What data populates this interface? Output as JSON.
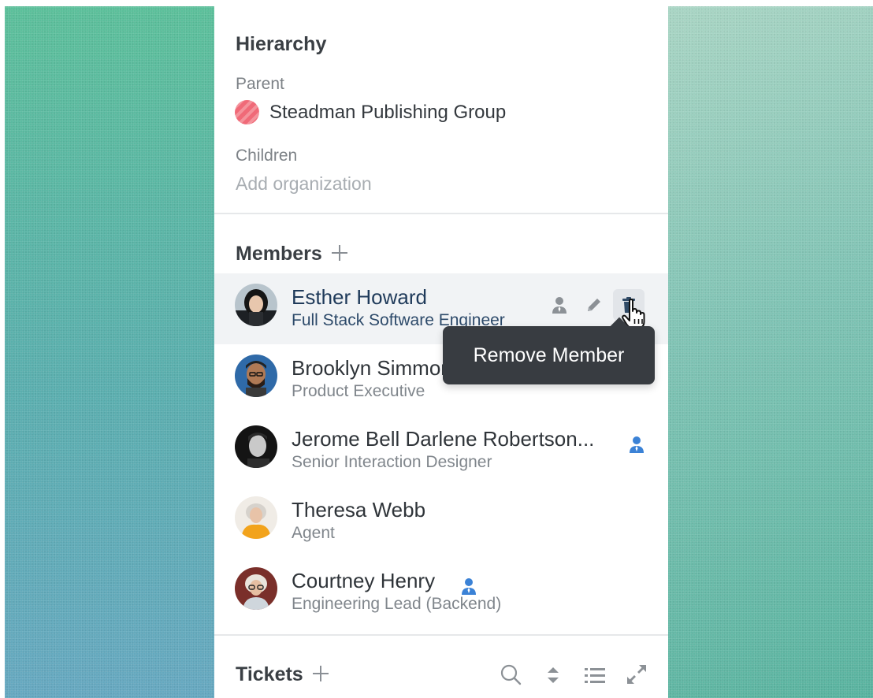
{
  "hierarchy": {
    "title": "Hierarchy",
    "parent_label": "Parent",
    "parent_name": "Steadman Publishing Group",
    "children_label": "Children",
    "add_organization": "Add organization"
  },
  "members": {
    "title": "Members",
    "list": [
      {
        "name": "Esther Howard",
        "role": "Full Stack Software Engineer"
      },
      {
        "name": "Brooklyn Simmons",
        "role": "Product Executive"
      },
      {
        "name": "Jerome Bell Darlene Robertson...",
        "role": "Senior Interaction Designer"
      },
      {
        "name": "Theresa Webb",
        "role": "Agent"
      },
      {
        "name": "Courtney Henry",
        "role": "Engineering Lead (Backend)"
      }
    ],
    "tooltip": "Remove Member"
  },
  "tickets": {
    "title": "Tickets"
  },
  "colors": {
    "accent_icon": "#3b82d6",
    "tooltip_bg": "#383c41",
    "parent_dot": "#f06a78"
  },
  "icons": [
    "user-tie-icon",
    "pencil-icon",
    "trash-icon",
    "hand-pointer-icon",
    "plus-icon",
    "search-icon",
    "sort-icon",
    "list-icon",
    "expand-icon"
  ]
}
